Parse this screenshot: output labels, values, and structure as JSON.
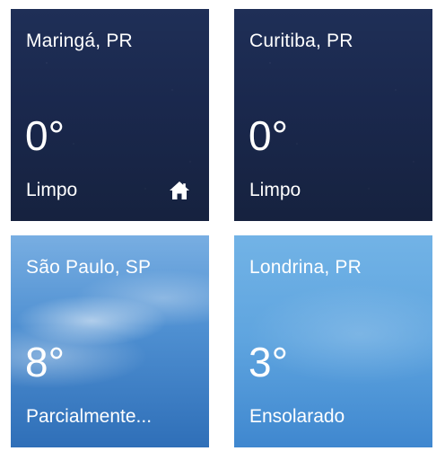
{
  "tiles": [
    {
      "city": "Maringá, PR",
      "temperature": "0°",
      "condition": "Limpo",
      "theme": "night",
      "home_icon": "home-icon"
    },
    {
      "city": "Curitiba, PR",
      "temperature": "0°",
      "condition": "Limpo",
      "theme": "night"
    },
    {
      "city": "São Paulo, SP",
      "temperature": "8°",
      "condition": "Parcialmente...",
      "theme": "clouds"
    },
    {
      "city": "Londrina, PR",
      "temperature": "3°",
      "condition": "Ensolarado",
      "theme": "sunny"
    }
  ],
  "colors": {
    "night_tile": "#1a284d",
    "day_tile_clouds": "#4e8fd1",
    "day_tile_sunny": "#5ea4df",
    "text": "#ffffff"
  }
}
